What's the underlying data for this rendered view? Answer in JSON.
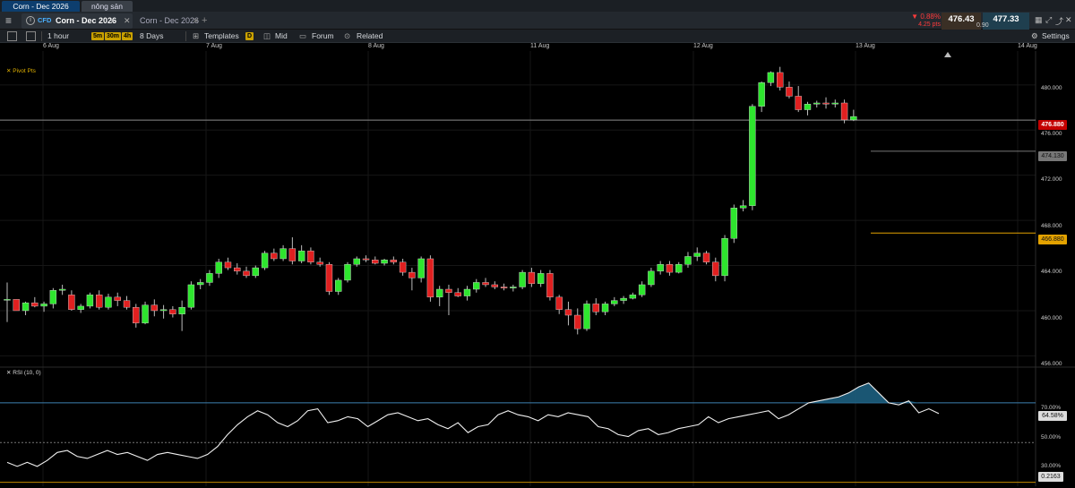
{
  "workspace_tabs": [
    "Corn - Dec 2026",
    "nông sản"
  ],
  "instrument": {
    "badge": "CFD",
    "name": "Corn - Dec 2026",
    "second_tab": "Corn - Dec 2026",
    "change_pct": "▼ 0.88%",
    "change_pts": "4.25 pts",
    "sell": "476.43",
    "buy": "477.33",
    "spread": "0.90"
  },
  "toolbar": {
    "timeframe": "1 hour",
    "chips": [
      "5m",
      "30m",
      "4h"
    ],
    "range": "8 Days",
    "templates": "Templates",
    "d_chip": "D",
    "price_mode": "Mid",
    "forum": "Forum",
    "related": "Related",
    "settings": "Settings"
  },
  "dates": [
    "6 Aug",
    "7 Aug",
    "8 Aug",
    "11 Aug",
    "12 Aug",
    "13 Aug",
    "14 Aug"
  ],
  "indicators": {
    "pivot": "Pivot Pts",
    "rsi": "RSI (10, 0)"
  },
  "price_axis": [
    "480.000",
    "476.000",
    "472.000",
    "468.000",
    "464.000",
    "460.000",
    "456.000"
  ],
  "tags": {
    "price": "476.880",
    "pivot1": "474.130",
    "pivot2": "466.880",
    "rsi": "64.58%",
    "rsi_low": "0.2163"
  },
  "rsi_axis": [
    "70.00%",
    "50.00%",
    "30.00%"
  ],
  "colors": {
    "up": "#2ee62e",
    "down": "#e02020",
    "accent": "#4ab0ff",
    "pivot": "#e3a200"
  },
  "chart_data": {
    "type": "candlestick",
    "price_axis_range": [
      455,
      483
    ],
    "candles": [
      [
        461,
        462.5,
        459,
        461
      ],
      [
        461,
        461,
        460,
        460
      ],
      [
        460,
        460.8,
        459.6,
        460.7
      ],
      [
        460.7,
        461.2,
        460.3,
        460.4
      ],
      [
        460.4,
        460.8,
        459.9,
        460.6
      ],
      [
        460.6,
        462,
        460.2,
        461.8
      ],
      [
        461.8,
        462.3,
        461.4,
        461.9
      ],
      [
        461.4,
        461.8,
        460,
        460.1
      ],
      [
        460.1,
        460.6,
        459.8,
        460.4
      ],
      [
        460.4,
        461.6,
        460.2,
        461.4
      ],
      [
        461.4,
        461.8,
        460.1,
        460.3
      ],
      [
        460.3,
        461.5,
        460.1,
        461.2
      ],
      [
        461.2,
        461.6,
        460.4,
        460.9
      ],
      [
        460.9,
        461.3,
        460.1,
        460.3
      ],
      [
        460.3,
        460.6,
        458.5,
        458.9
      ],
      [
        458.9,
        460.8,
        458.8,
        460.5
      ],
      [
        460.5,
        461,
        459.5,
        460
      ],
      [
        460,
        460.5,
        459.3,
        460.1
      ],
      [
        460.1,
        460.4,
        459.4,
        459.7
      ],
      [
        459.7,
        460.9,
        458.2,
        460.3
      ],
      [
        460.3,
        462.6,
        460.1,
        462.3
      ],
      [
        462.3,
        462.8,
        461.9,
        462.5
      ],
      [
        462.5,
        463.6,
        462.2,
        463.3
      ],
      [
        463.3,
        464.6,
        462.9,
        464.3
      ],
      [
        464.3,
        464.7,
        463.6,
        463.8
      ],
      [
        463.8,
        464.2,
        463.2,
        463.5
      ],
      [
        463.5,
        463.9,
        462.9,
        463.1
      ],
      [
        463.1,
        464,
        462.9,
        463.8
      ],
      [
        463.8,
        465.3,
        463.6,
        465.1
      ],
      [
        465.1,
        465.5,
        464.4,
        464.6
      ],
      [
        464.6,
        465.8,
        464.4,
        465.5
      ],
      [
        465.5,
        466.5,
        464.1,
        464.4
      ],
      [
        464.4,
        465.8,
        464.2,
        465.3
      ],
      [
        465.3,
        465.6,
        464.1,
        464.3
      ],
      [
        464.3,
        464.7,
        463.9,
        464.1
      ],
      [
        464.1,
        464.3,
        461.4,
        461.7
      ],
      [
        461.7,
        462.9,
        461.4,
        462.7
      ],
      [
        462.7,
        464.3,
        462.5,
        464.1
      ],
      [
        464.1,
        464.8,
        463.9,
        464.6
      ],
      [
        464.6,
        464.9,
        464.3,
        464.5
      ],
      [
        464.5,
        464.8,
        464.1,
        464.2
      ],
      [
        464.2,
        464.6,
        464,
        464.5
      ],
      [
        464.5,
        464.8,
        464.1,
        464.3
      ],
      [
        464.3,
        464.6,
        463.1,
        463.4
      ],
      [
        463.4,
        463.8,
        461.8,
        462.9
      ],
      [
        462.9,
        464.8,
        462.5,
        464.6
      ],
      [
        464.6,
        464.9,
        460.8,
        461.2
      ],
      [
        461.2,
        462.2,
        460.4,
        461.9
      ],
      [
        461.9,
        462.3,
        459.6,
        461.6
      ],
      [
        461.6,
        462,
        461.2,
        461.3
      ],
      [
        461.3,
        462.2,
        460.9,
        461.9
      ],
      [
        461.9,
        462.8,
        461.6,
        462.5
      ],
      [
        462.5,
        462.9,
        462.1,
        462.3
      ],
      [
        462.3,
        462.6,
        461.9,
        462.1
      ],
      [
        462.1,
        462.4,
        461.8,
        462
      ],
      [
        462,
        462.3,
        461.7,
        462.1
      ],
      [
        462.1,
        463.6,
        461.9,
        463.4
      ],
      [
        463.4,
        463.8,
        462.1,
        462.4
      ],
      [
        462.4,
        463.6,
        462.1,
        463.3
      ],
      [
        463.3,
        463.6,
        460.9,
        461.2
      ],
      [
        461.2,
        461.4,
        459.7,
        460.1
      ],
      [
        460.1,
        460.8,
        458.7,
        459.6
      ],
      [
        459.6,
        460.2,
        457.9,
        458.4
      ],
      [
        458.4,
        460.9,
        458.2,
        460.6
      ],
      [
        460.6,
        461.1,
        459.6,
        459.9
      ],
      [
        459.9,
        460.8,
        459.6,
        460.6
      ],
      [
        460.6,
        461.2,
        460.4,
        460.9
      ],
      [
        460.9,
        461.3,
        460.6,
        461.1
      ],
      [
        461.1,
        461.6,
        461,
        461.4
      ],
      [
        461.4,
        462.6,
        461.2,
        462.3
      ],
      [
        462.3,
        463.8,
        462.1,
        463.5
      ],
      [
        463.5,
        464.4,
        463.2,
        464.1
      ],
      [
        464.1,
        464.4,
        463.1,
        463.4
      ],
      [
        463.4,
        464.3,
        463.3,
        464.1
      ],
      [
        464.1,
        465.2,
        463.8,
        464.8
      ],
      [
        464.8,
        465.6,
        464.4,
        465.1
      ],
      [
        465.1,
        465.3,
        464.1,
        464.3
      ],
      [
        464.3,
        464.7,
        462.6,
        463.1
      ],
      [
        463.1,
        466.7,
        462.6,
        466.4
      ],
      [
        466.4,
        469.4,
        466,
        469.1
      ],
      [
        469.1,
        469.8,
        468.8,
        469.3
      ],
      [
        469.3,
        478.3,
        468.9,
        478.1
      ],
      [
        478.1,
        480.3,
        477.6,
        480.2
      ],
      [
        480.2,
        481.2,
        479.9,
        481.1
      ],
      [
        481.1,
        481.6,
        479.5,
        479.8
      ],
      [
        479.8,
        480.3,
        478.8,
        479
      ],
      [
        479,
        479.9,
        477.6,
        477.8
      ],
      [
        477.8,
        478.5,
        477.3,
        478.3
      ],
      [
        478.3,
        478.6,
        478,
        478.4
      ],
      [
        478.4,
        478.9,
        477.9,
        478.3
      ],
      [
        478.3,
        478.7,
        478,
        478.4
      ],
      [
        478.4,
        478.7,
        476.6,
        476.9
      ],
      [
        476.9,
        477.8,
        476.8,
        477.2
      ]
    ],
    "pivot_levels": [
      474.13,
      466.88
    ],
    "current_price": 476.88,
    "rsi": {
      "axis_range": [
        28,
        88
      ],
      "levels": [
        70,
        50,
        30
      ],
      "values": [
        40,
        38,
        40,
        38,
        41,
        45,
        46,
        43,
        42,
        44,
        46,
        44,
        45,
        43,
        41,
        44,
        45,
        44,
        43,
        42,
        44,
        48,
        54,
        59,
        63,
        66,
        64,
        60,
        58,
        61,
        66,
        67,
        60,
        61,
        63,
        62,
        58,
        61,
        64,
        65,
        63,
        61,
        62,
        59,
        57,
        60,
        55,
        58,
        59,
        64,
        66,
        64,
        63,
        61,
        64,
        63,
        65,
        64,
        63,
        58,
        57,
        54,
        53,
        56,
        57,
        54,
        55,
        57,
        58,
        59,
        63,
        60,
        62,
        63,
        64,
        65,
        66,
        62,
        64,
        67,
        70,
        71,
        72,
        73,
        75,
        78,
        80,
        75,
        70,
        69,
        71,
        65,
        67,
        64.58
      ]
    }
  }
}
